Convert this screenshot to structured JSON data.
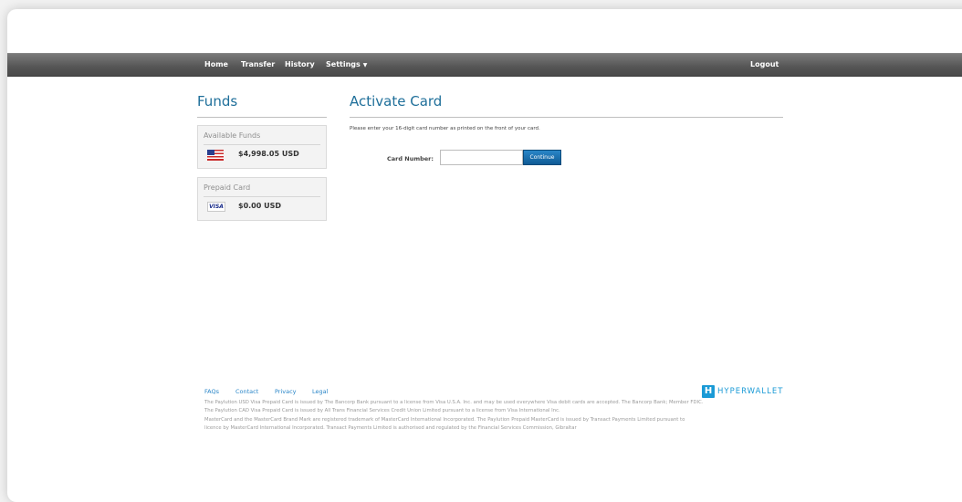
{
  "nav": {
    "home": "Home",
    "transfer": "Transfer",
    "history": "History",
    "settings": "Settings",
    "logout": "Logout"
  },
  "sidebar": {
    "title": "Funds",
    "available_funds": {
      "label": "Available Funds",
      "flag_icon": "us-flag-icon",
      "amount": "$4,998.05 USD"
    },
    "prepaid_card": {
      "label": "Prepaid Card",
      "card_icon": "visa-icon",
      "card_brand": "VISA",
      "amount": "$0.00 USD"
    }
  },
  "main": {
    "title": "Activate Card",
    "instructions": "Please enter your 16-digit card number as printed on the front of your card.",
    "card_number_label": "Card Number:",
    "card_number_value": "",
    "continue_label": "Continue"
  },
  "footer": {
    "links": [
      "FAQs",
      "Contact",
      "Privacy",
      "Legal"
    ],
    "logo_mark": "H",
    "logo_text": "HYPERWALLET",
    "legal": [
      "The Paylution USD Visa Prepaid Card is issued by The Bancorp Bank pursuant to a license from Visa U.S.A. Inc. and may be used everywhere Visa debit cards are accepted. The Bancorp Bank; Member FDIC.",
      "The Paylution CAD Visa Prepaid Card is issued by All Trans Financial Services Credit Union Limited pursuant to a license from Visa International Inc.",
      "MasterCard and the MasterCard Brand Mark are registered trademark of MasterCard International Incorporated. The Paylution Prepaid MasterCard is issued by Transact Payments Limited pursuant to",
      "licence by MasterCard International Incorporated. Transact Payments Limited is authorised and regulated by the Financial Services Commission, Gibraltar"
    ]
  },
  "colors": {
    "accent": "#1f6f9a",
    "link": "#2a86c8",
    "button": "#0f5b95",
    "navbar": "#555555"
  }
}
